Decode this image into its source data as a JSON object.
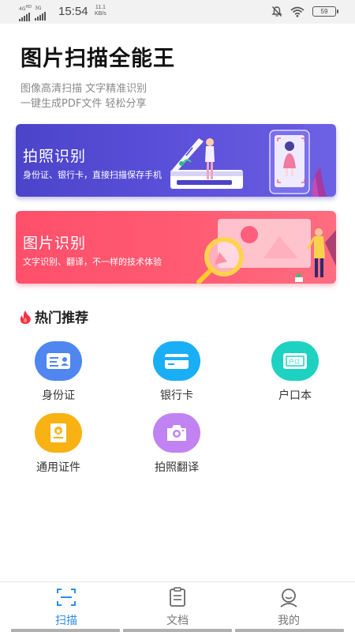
{
  "status_bar": {
    "net_top": "4G",
    "net_sup": "HD",
    "net_2": "3G",
    "time": "15:54",
    "speed_value": "11.1",
    "speed_unit": "KB/s",
    "battery": "59"
  },
  "header": {
    "title": "图片扫描全能王",
    "subtitle_line1": "图像高清扫描 文字精准识别",
    "subtitle_line2": "一键生成PDF文件 轻松分享"
  },
  "banners": [
    {
      "title": "拍照识别",
      "desc": "身份证、银行卡，直接扫描保存手机",
      "color": "#4b44c9",
      "icon": "scanner-illustration"
    },
    {
      "title": "图片识别",
      "desc": "文字识别、翻译，不一样的技术体验",
      "color": "#ff4f6b",
      "icon": "image-magnifier-illustration"
    }
  ],
  "hot": {
    "title": "热门推荐",
    "icon": "flame-icon",
    "items": [
      {
        "label": "身份证",
        "color": "#4f86f0",
        "icon": "id-card-icon"
      },
      {
        "label": "银行卡",
        "color": "#1aaef5",
        "icon": "bank-card-icon"
      },
      {
        "label": "户口本",
        "color": "#1dd2c0",
        "icon": "household-book-icon"
      },
      {
        "label": "通用证件",
        "color": "#f9b213",
        "icon": "certificate-icon"
      },
      {
        "label": "拍照翻译",
        "color": "#c183f2",
        "icon": "camera-icon"
      }
    ]
  },
  "tabs": [
    {
      "label": "扫描",
      "icon": "scan-icon",
      "active": true
    },
    {
      "label": "文档",
      "icon": "document-icon",
      "active": false
    },
    {
      "label": "我的",
      "icon": "profile-icon",
      "active": false
    }
  ],
  "colors": {
    "accent": "#2f8ce8",
    "flame": "#f0324a"
  }
}
